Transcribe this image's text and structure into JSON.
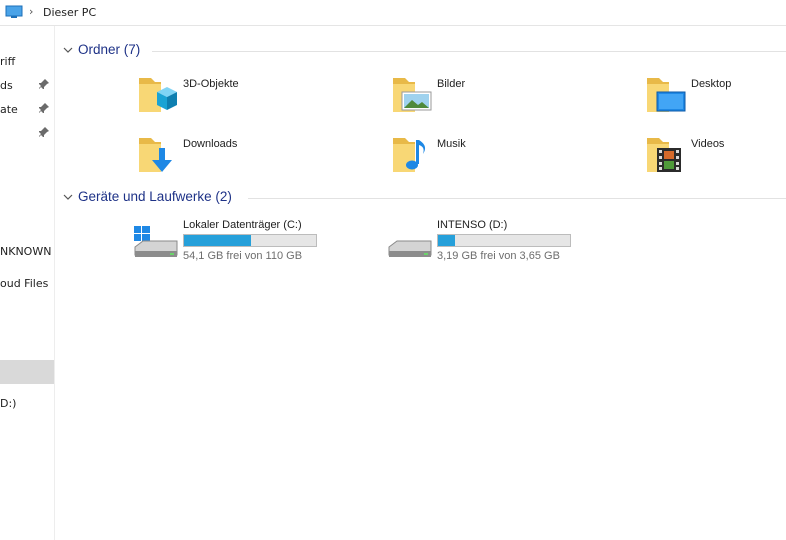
{
  "address": {
    "path": "Dieser PC"
  },
  "nav": {
    "items": [
      {
        "label": "riff",
        "pinned": false
      },
      {
        "label": "ds",
        "pinned": true
      },
      {
        "label": "ate",
        "pinned": true
      },
      {
        "label": "",
        "pinned": true
      },
      {
        "label": "NKNOWN",
        "pinned": false
      },
      {
        "label": "oud Files",
        "pinned": false
      },
      {
        "label": "",
        "pinned": false,
        "selected": true
      },
      {
        "label": "D:)",
        "pinned": false
      }
    ]
  },
  "groups": {
    "folders": {
      "title": "Ordner (7)",
      "items": [
        {
          "name": "3D-Objekte",
          "icon": "3d-objects-folder-icon"
        },
        {
          "name": "Bilder",
          "icon": "pictures-folder-icon"
        },
        {
          "name": "Desktop",
          "icon": "desktop-folder-icon"
        },
        {
          "name": "Downloads",
          "icon": "downloads-folder-icon"
        },
        {
          "name": "Musik",
          "icon": "music-folder-icon"
        },
        {
          "name": "Videos",
          "icon": "videos-folder-icon"
        }
      ]
    },
    "drives": {
      "title": "Geräte und Laufwerke (2)",
      "items": [
        {
          "name": "Lokaler Datenträger (C:)",
          "free_text": "54,1 GB frei von 110 GB",
          "used_fraction": 0.51,
          "icon": "windows-drive-icon"
        },
        {
          "name": "INTENSO (D:)",
          "free_text": "3,19 GB frei von 3,65 GB",
          "used_fraction": 0.13,
          "icon": "usb-drive-icon"
        }
      ]
    }
  },
  "colors": {
    "accent": "#26a0da",
    "group_title": "#1e3287",
    "folder": "#f8d775"
  }
}
